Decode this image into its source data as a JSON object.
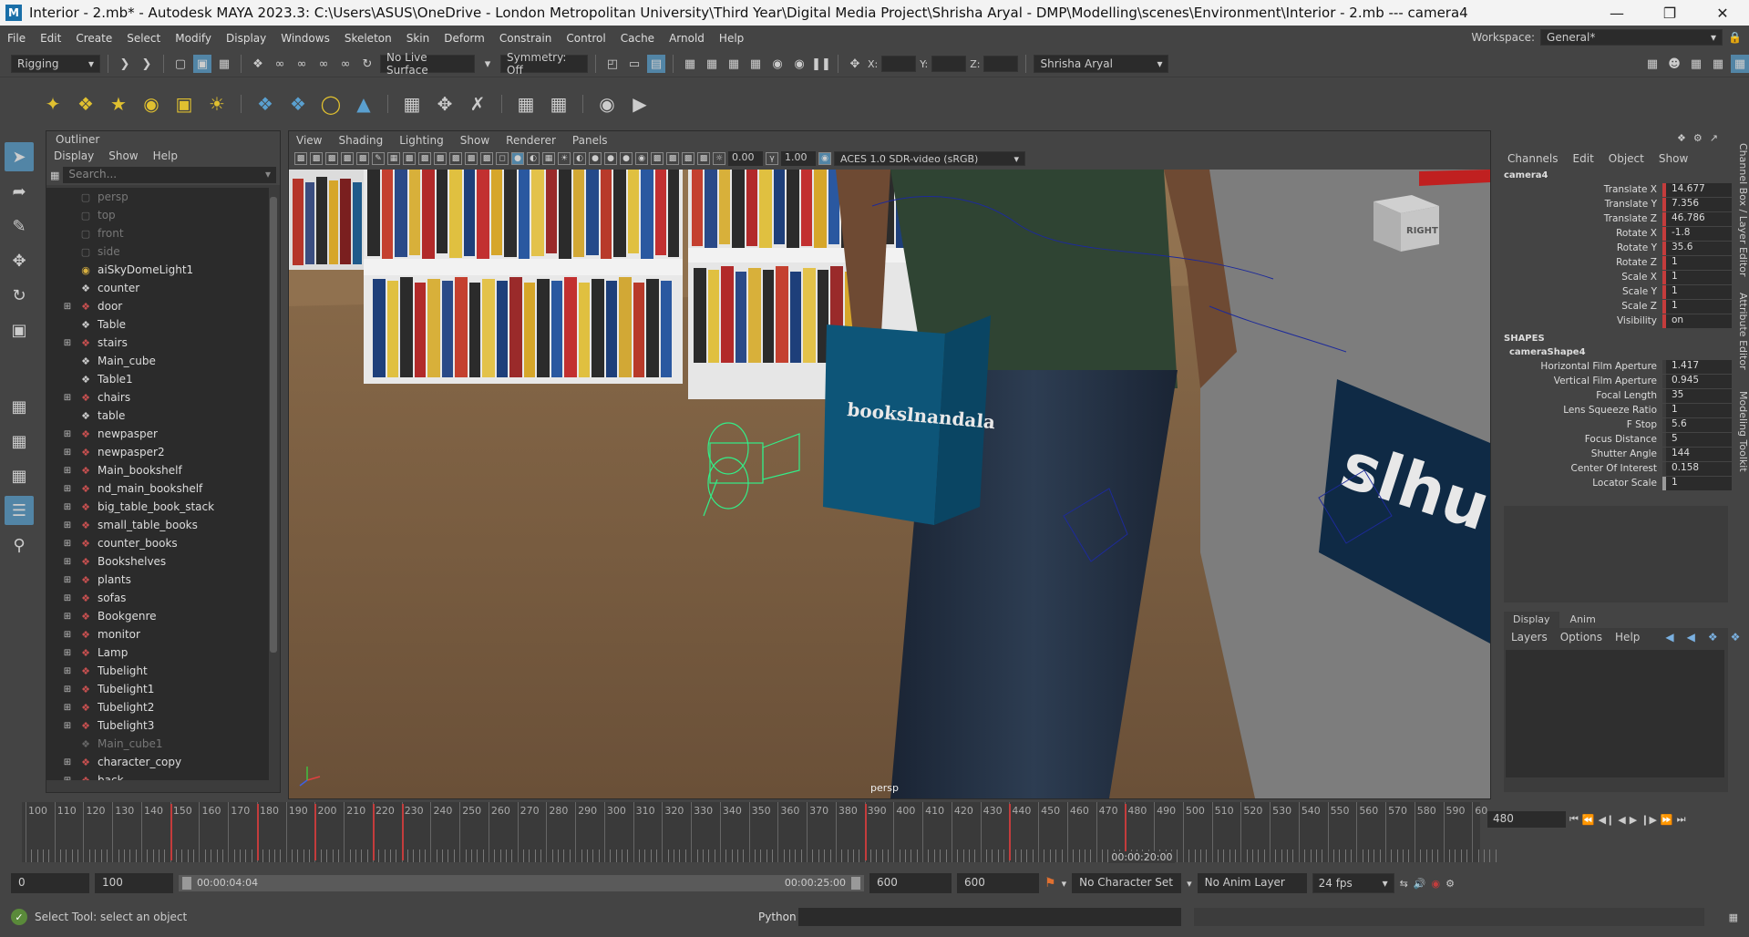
{
  "window": {
    "title": "Interior - 2.mb* - Autodesk MAYA 2023.3: C:\\Users\\ASUS\\OneDrive - London Metropolitan University\\Third Year\\Digital Media Project\\Shrisha Aryal - DMP\\Modelling\\scenes\\Environment\\Interior - 2.mb  ---   camera4",
    "app_icon": "M"
  },
  "menubar": {
    "items": [
      "File",
      "Edit",
      "Create",
      "Select",
      "Modify",
      "Display",
      "Windows",
      "Skeleton",
      "Skin",
      "Deform",
      "Constrain",
      "Control",
      "Cache",
      "Arnold",
      "Help"
    ],
    "workspace_label": "Workspace:",
    "workspace_value": "General*"
  },
  "statusline": {
    "menuset": "Rigging",
    "live_surface": "No Live Surface",
    "symmetry": "Symmetry: Off",
    "x_label": "X:",
    "y_label": "Y:",
    "z_label": "Z:",
    "user": "Shrisha Aryal"
  },
  "outliner": {
    "title": "Outliner",
    "menu": [
      "Display",
      "Show",
      "Help"
    ],
    "search_placeholder": "Search...",
    "items": [
      {
        "label": "persp",
        "type": "camera",
        "expand": false,
        "dim": true
      },
      {
        "label": "top",
        "type": "camera",
        "expand": false,
        "dim": true
      },
      {
        "label": "front",
        "type": "camera",
        "expand": false,
        "dim": true
      },
      {
        "label": "side",
        "type": "camera",
        "expand": false,
        "dim": true
      },
      {
        "label": "aiSkyDomeLight1",
        "type": "light",
        "expand": false,
        "dim": false
      },
      {
        "label": "counter",
        "type": "mesh",
        "expand": false,
        "dim": false
      },
      {
        "label": "door",
        "type": "group",
        "expand": true,
        "dim": false
      },
      {
        "label": "Table",
        "type": "mesh",
        "expand": false,
        "dim": false
      },
      {
        "label": "stairs",
        "type": "group",
        "expand": true,
        "dim": false
      },
      {
        "label": "Main_cube",
        "type": "mesh",
        "expand": false,
        "dim": false
      },
      {
        "label": "Table1",
        "type": "mesh",
        "expand": false,
        "dim": false
      },
      {
        "label": "chairs",
        "type": "group",
        "expand": true,
        "dim": false
      },
      {
        "label": "table",
        "type": "mesh",
        "expand": false,
        "dim": false
      },
      {
        "label": "newpasper",
        "type": "group",
        "expand": true,
        "dim": false
      },
      {
        "label": "newpasper2",
        "type": "group",
        "expand": true,
        "dim": false
      },
      {
        "label": "Main_bookshelf",
        "type": "group",
        "expand": true,
        "dim": false
      },
      {
        "label": "nd_main_bookshelf",
        "type": "group",
        "expand": true,
        "dim": false
      },
      {
        "label": "big_table_book_stack",
        "type": "group",
        "expand": true,
        "dim": false
      },
      {
        "label": "small_table_books",
        "type": "group",
        "expand": true,
        "dim": false
      },
      {
        "label": "counter_books",
        "type": "group",
        "expand": true,
        "dim": false
      },
      {
        "label": "Bookshelves",
        "type": "group",
        "expand": true,
        "dim": false
      },
      {
        "label": "plants",
        "type": "group",
        "expand": true,
        "dim": false
      },
      {
        "label": "sofas",
        "type": "group",
        "expand": true,
        "dim": false
      },
      {
        "label": "Bookgenre",
        "type": "group",
        "expand": true,
        "dim": false
      },
      {
        "label": "monitor",
        "type": "group",
        "expand": true,
        "dim": false
      },
      {
        "label": "Lamp",
        "type": "group",
        "expand": true,
        "dim": false
      },
      {
        "label": "Tubelight",
        "type": "group",
        "expand": true,
        "dim": false
      },
      {
        "label": "Tubelight1",
        "type": "group",
        "expand": true,
        "dim": false
      },
      {
        "label": "Tubelight2",
        "type": "group",
        "expand": true,
        "dim": false
      },
      {
        "label": "Tubelight3",
        "type": "group",
        "expand": true,
        "dim": false
      },
      {
        "label": "Main_cube1",
        "type": "mesh",
        "expand": false,
        "dim": true
      },
      {
        "label": "character_copy",
        "type": "group",
        "expand": true,
        "dim": false
      },
      {
        "label": "back",
        "type": "group",
        "expand": true,
        "dim": false
      }
    ]
  },
  "viewport": {
    "menu": [
      "View",
      "Shading",
      "Lighting",
      "Show",
      "Renderer",
      "Panels"
    ],
    "exposure": "0.00",
    "gamma": "1.00",
    "color_space": "ACES 1.0 SDR-video (sRGB)",
    "camera_label": "persp",
    "viewcube_label": "RIGHT",
    "bag_text": "bookslnandala",
    "banner_text": "slhu"
  },
  "channelbox": {
    "menu": [
      "Channels",
      "Edit",
      "Object",
      "Show"
    ],
    "object": "camera4",
    "attributes": [
      {
        "name": "Translate X",
        "value": "14.677"
      },
      {
        "name": "Translate Y",
        "value": "7.356"
      },
      {
        "name": "Translate Z",
        "value": "46.786"
      },
      {
        "name": "Rotate X",
        "value": "-1.8"
      },
      {
        "name": "Rotate Y",
        "value": "35.6"
      },
      {
        "name": "Rotate Z",
        "value": "1"
      },
      {
        "name": "Scale X",
        "value": "1"
      },
      {
        "name": "Scale Y",
        "value": "1"
      },
      {
        "name": "Scale Z",
        "value": "1"
      },
      {
        "name": "Visibility",
        "value": "on"
      }
    ],
    "shapes_label": "SHAPES",
    "shape_name": "cameraShape4",
    "shape_attributes": [
      {
        "name": "Horizontal Film Aperture",
        "value": "1.417"
      },
      {
        "name": "Vertical Film Aperture",
        "value": "0.945"
      },
      {
        "name": "Focal Length",
        "value": "35"
      },
      {
        "name": "Lens Squeeze Ratio",
        "value": "1"
      },
      {
        "name": "F Stop",
        "value": "5.6"
      },
      {
        "name": "Focus Distance",
        "value": "5"
      },
      {
        "name": "Shutter Angle",
        "value": "144"
      },
      {
        "name": "Center Of Interest",
        "value": "0.158"
      },
      {
        "name": "Locator Scale",
        "value": "1"
      }
    ],
    "layer_tabs": [
      "Display",
      "Anim"
    ],
    "layer_menu": [
      "Layers",
      "Options",
      "Help"
    ],
    "side_tabs": [
      "Channel Box / Layer Editor",
      "Attribute Editor",
      "Modeling Toolkit"
    ]
  },
  "timeslider": {
    "labels": [
      "100",
      "110",
      "120",
      "130",
      "140",
      "150",
      "160",
      "170",
      "180",
      "190",
      "200",
      "210",
      "220",
      "230",
      "240",
      "250",
      "260",
      "270",
      "280",
      "290",
      "300",
      "310",
      "320",
      "330",
      "340",
      "350",
      "360",
      "370",
      "380",
      "390",
      "400",
      "410",
      "420",
      "430",
      "440",
      "450",
      "460",
      "470",
      "480",
      "490",
      "500",
      "510",
      "520",
      "530",
      "540",
      "550",
      "560",
      "570",
      "580",
      "590",
      "60"
    ],
    "current_time": "00:00:20:00",
    "current_frame": "480"
  },
  "rangeslider": {
    "start": "0",
    "playback_start": "100",
    "range_start_time": "00:00:04:04",
    "range_end_time": "00:00:25:00",
    "playback_end": "600",
    "end": "600",
    "character_set": "No Character Set",
    "anim_layer": "No Anim Layer",
    "fps": "24 fps"
  },
  "cmdline": {
    "help_text": "Select Tool: select an object",
    "language": "Python"
  }
}
